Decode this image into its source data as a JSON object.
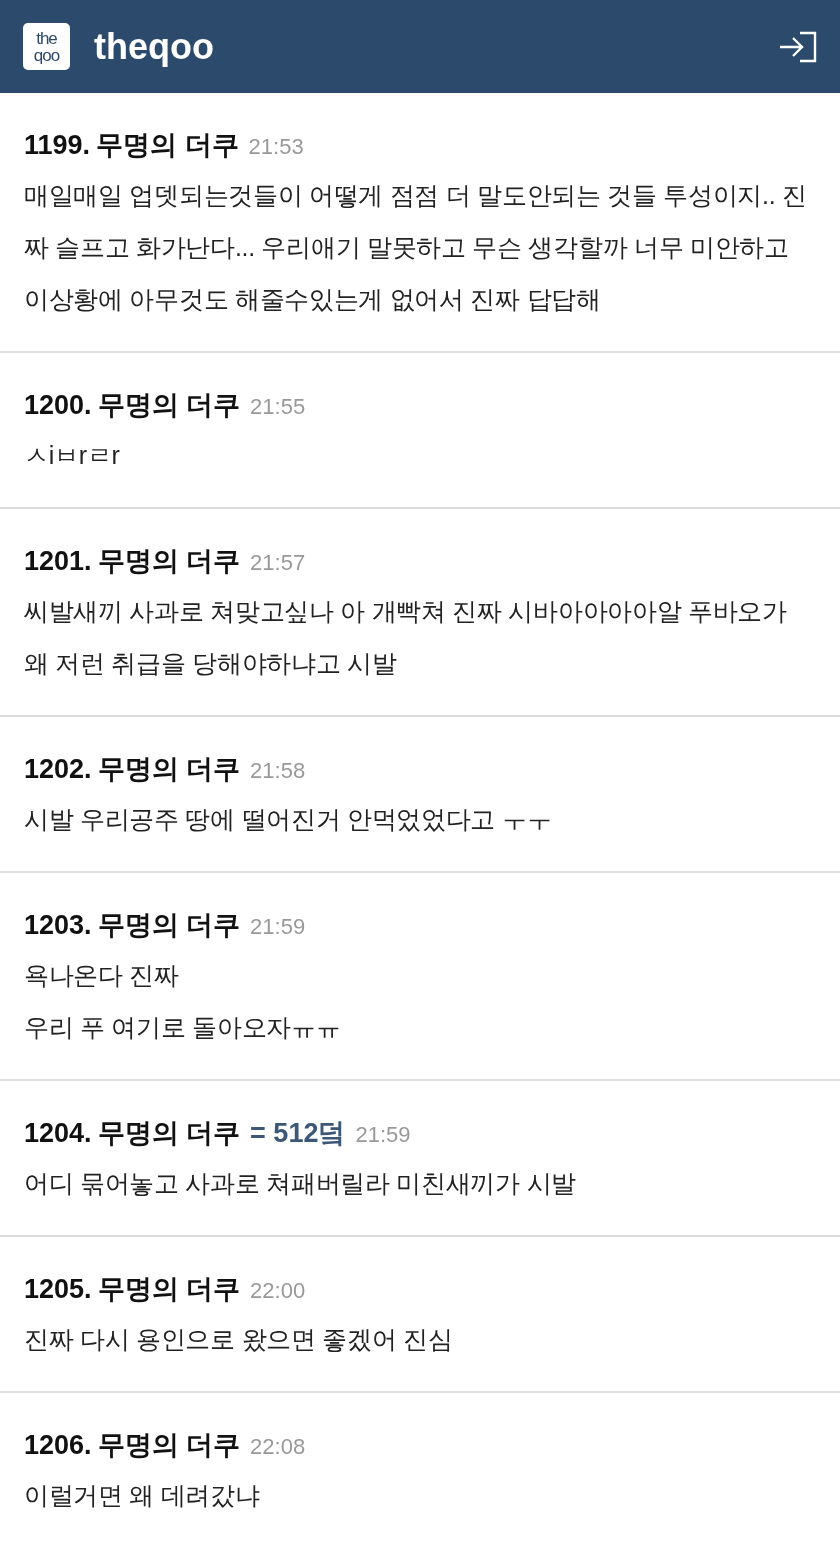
{
  "header": {
    "title": "theqoo",
    "logo": "theqoo"
  },
  "comments": [
    {
      "number": "1199.",
      "author": "무명의 더쿠",
      "time": "21:53",
      "body": "매일매일 업뎃되는것들이 어떻게 점점 더 말도안되는 것들 투성이지.. 진짜 슬프고 화가난다... 우리애기 말못하고 무슨 생각할까 너무 미안하고 이상황에 아무것도 해줄수있는게 없어서 진짜 답답해"
    },
    {
      "number": "1200.",
      "author": "무명의 더쿠",
      "time": "21:55",
      "body": "ㅅiㅂrㄹr"
    },
    {
      "number": "1201.",
      "author": "무명의 더쿠",
      "time": "21:57",
      "body": "씨발새끼 사과로 쳐맞고싶나 아 개빡쳐 진짜 시바아아아아알 푸바오가 왜 저런 취급을 당해야하냐고 시발"
    },
    {
      "number": "1202.",
      "author": "무명의 더쿠",
      "time": "21:58",
      "body": "시발 우리공주 땅에 떨어진거 안먹었었다고 ㅜㅜ"
    },
    {
      "number": "1203.",
      "author": "무명의 더쿠",
      "time": "21:59",
      "body": "욕나온다 진짜\n우리 푸 여기로 돌아오자ㅠㅠ"
    },
    {
      "number": "1204.",
      "author": "무명의 더쿠",
      "badge": "= 512덬",
      "time": "21:59",
      "body": "어디 묶어놓고 사과로 쳐패버릴라 미친새끼가 시발"
    },
    {
      "number": "1205.",
      "author": "무명의 더쿠",
      "time": "22:00",
      "body": "진짜 다시 용인으로 왔으면 좋겠어 진심"
    },
    {
      "number": "1206.",
      "author": "무명의 더쿠",
      "time": "22:08",
      "body": "이럴거면 왜 데려갔냐"
    }
  ]
}
